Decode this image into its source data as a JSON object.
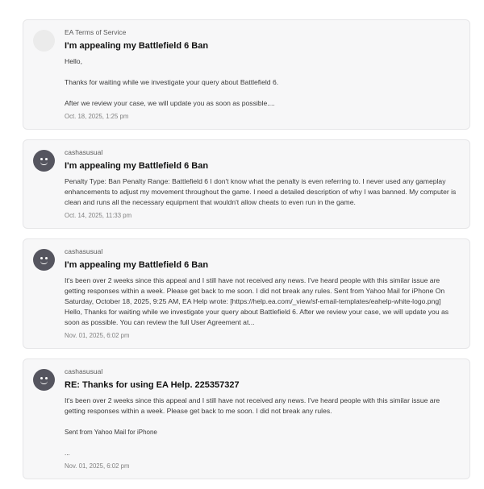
{
  "messages": [
    {
      "sender": "EA Terms of Service",
      "subject": "I'm appealing my Battlefield 6 Ban",
      "paragraphs": [
        "Hello,",
        "Thanks for waiting while we investigate your query about Battlefield 6.",
        "After we review your case, we will update you as soon as possible...."
      ],
      "timestamp": "Oct. 18, 2025, 1:25 pm",
      "avatar": "blank-avatar"
    },
    {
      "sender": "cashasusual",
      "subject": "I'm appealing my Battlefield 6 Ban",
      "paragraphs": [
        "Penalty Type: Ban Penalty Range: Battlefield 6 I don't know what the penalty is even referring to. I never used any gameplay enhancements to adjust my movement throughout the game. I need a detailed description of why I was banned. My computer is clean and runs all the necessary equipment that wouldn't allow cheats to even run in the game."
      ],
      "timestamp": "Oct. 14, 2025, 11:33 pm",
      "avatar": "smiley-face-avatar"
    },
    {
      "sender": "cashasusual",
      "subject": "I'm appealing my Battlefield 6 Ban",
      "paragraphs": [
        "It's been over 2 weeks since this appeal and I still have not received any news. I've heard people with this similar issue are getting responses within a week. Please get back to me soon. I did not break any rules. Sent from Yahoo Mail for iPhone On Saturday, October 18, 2025, 9:25 AM, EA Help wrote: [https://help.ea.com/_view/sf-email-templates/eahelp-white-logo.png] Hello, Thanks for waiting while we investigate your query about Battlefield 6. After we review your case, we will update you as soon as possible. You can review the full User Agreement at..."
      ],
      "timestamp": "Nov. 01, 2025, 6:02 pm",
      "avatar": "smiley-face-avatar"
    },
    {
      "sender": "cashasusual",
      "subject": "RE: Thanks for using EA Help. 225357327",
      "paragraphs": [
        "It's been over 2 weeks since this appeal and I still have not received any news. I've heard people with this similar issue are getting responses within a week. Please get back to me soon. I did not break any rules.",
        "Sent from Yahoo Mail for iPhone"
      ],
      "ellipsis": "...",
      "timestamp": "Nov. 01, 2025, 6:02 pm",
      "avatar": "smiley-face-avatar"
    }
  ]
}
